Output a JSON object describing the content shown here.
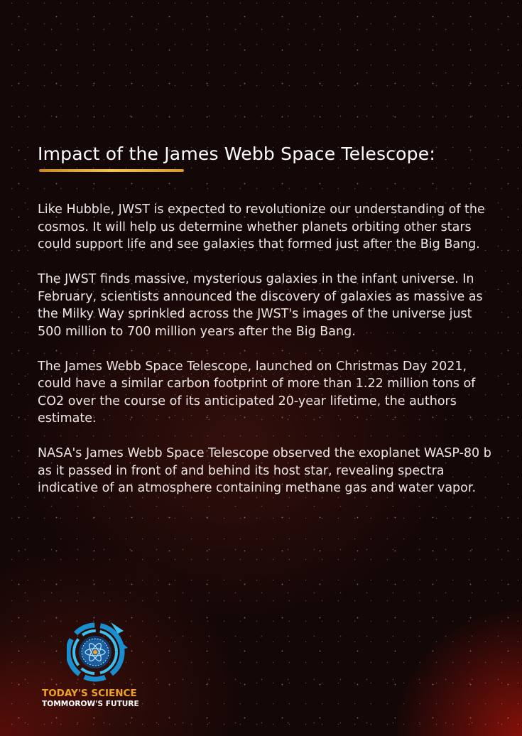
{
  "heading": "Impact of the James Webb Space Telescope:",
  "paragraphs": [
    "Like Hubble, JWST is expected to revolutionize our understanding of the cosmos. It will help us determine whether planets orbiting other stars could support life and see galaxies that formed just after the Big Bang.",
    "The JWST finds massive, mysterious galaxies in the infant universe. In February, scientists announced the discovery of galaxies as massive as the Milky Way sprinkled across the JWST's images of the universe just 500 million to 700 million years after the Big Bang.",
    "The James Webb Space Telescope, launched on Christmas Day 2021, could have a similar carbon footprint of more than 1.22 million tons of CO2 over the course of its anticipated 20-year lifetime, the authors estimate.",
    "NASA's James Webb Space Telescope observed the exoplanet WASP-80 b as it passed in front of and behind its host star, revealing spectra indicative of an atmosphere containing methane gas and water vapor."
  ],
  "logo": {
    "line1": "TODAY'S SCIENCE",
    "line2": "TOMMOROW'S FUTURE",
    "emblem": "atom-globe-icon"
  },
  "colors": {
    "background": "#140707",
    "accent_gold": "#f3c44e",
    "logo_orange": "#f0a321",
    "logo_blue": "#1fa3e0",
    "text": "#eee6e6"
  }
}
